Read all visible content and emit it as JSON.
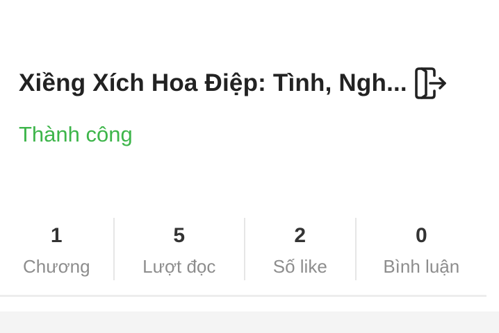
{
  "story": {
    "title": "Xiềng Xích Hoa Điệp: Tình, Ngh...",
    "status": "Thành công",
    "exit_icon": "exit-icon"
  },
  "stats": [
    {
      "value": "1",
      "label": "Chương"
    },
    {
      "value": "5",
      "label": "Lượt đọc"
    },
    {
      "value": "2",
      "label": "Số like"
    },
    {
      "value": "0",
      "label": "Bình luận"
    }
  ],
  "colors": {
    "status": "#3db54a",
    "title": "#222222",
    "stat_value": "#333333",
    "stat_label": "#8d8d8d"
  }
}
